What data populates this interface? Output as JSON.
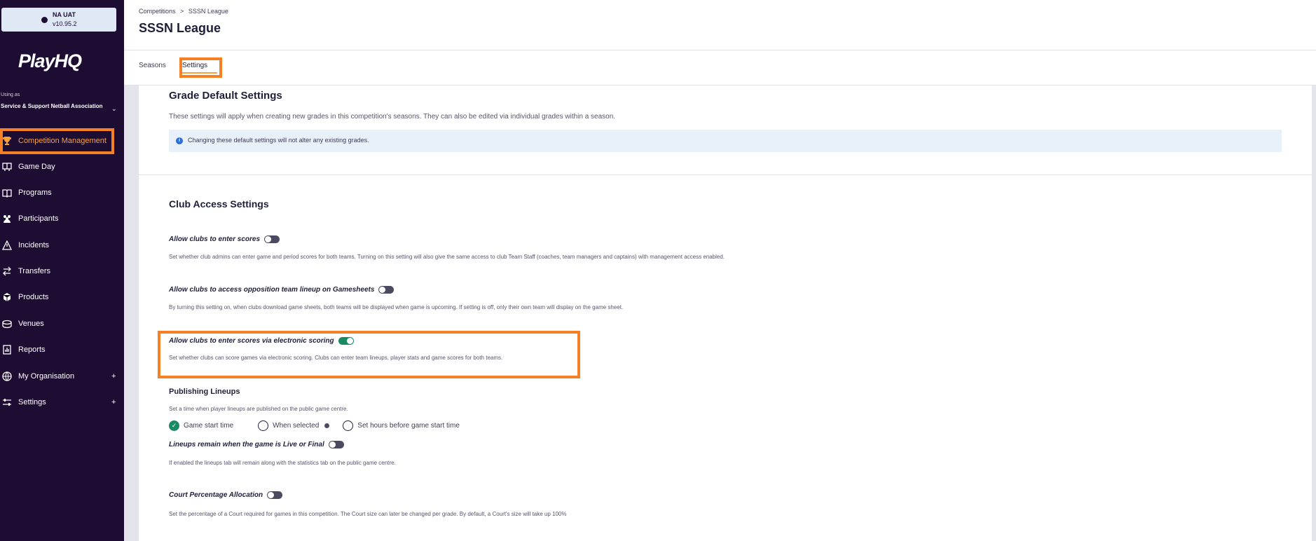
{
  "sidebar": {
    "env": {
      "name": "NA UAT",
      "version": "v10.95.2"
    },
    "logo": "PlayHQ",
    "using_as": "Using as",
    "organisation": "Service & Support Netball Association",
    "items": [
      {
        "label": "Competition Management",
        "icon": "trophy-icon",
        "active": true
      },
      {
        "label": "Game Day",
        "icon": "scoreboard-icon"
      },
      {
        "label": "Programs",
        "icon": "book-icon"
      },
      {
        "label": "Participants",
        "icon": "people-icon"
      },
      {
        "label": "Incidents",
        "icon": "warning-icon"
      },
      {
        "label": "Transfers",
        "icon": "transfer-arrows-icon"
      },
      {
        "label": "Products",
        "icon": "boxes-icon"
      },
      {
        "label": "Venues",
        "icon": "stadium-icon"
      },
      {
        "label": "Reports",
        "icon": "report-icon"
      },
      {
        "label": "My Organisation",
        "icon": "globe-icon",
        "expandable": true
      },
      {
        "label": "Settings",
        "icon": "sliders-icon",
        "expandable": true
      }
    ],
    "expand_symbol": "+"
  },
  "header": {
    "breadcrumb": [
      "Competitions",
      "SSSN League"
    ],
    "breadcrumb_sep": ">",
    "title": "SSSN League"
  },
  "tabs": [
    {
      "label": "Seasons"
    },
    {
      "label": "Settings",
      "active": true
    }
  ],
  "grade_defaults": {
    "title": "Grade Default Settings",
    "description": "These settings will apply when creating new grades in this competition's seasons. They can also be edited via individual grades within a season.",
    "info": "Changing these default settings will not alter any existing grades."
  },
  "club_access": {
    "title": "Club Access Settings",
    "settings": [
      {
        "label": "Allow clubs to enter scores",
        "on": false,
        "description": "Set whether club admins can enter game and period scores for both teams. Turning on this setting will also give the same access to club Team Staff (coaches, team managers and captains) with management access enabled."
      },
      {
        "label": "Allow clubs to access opposition team lineup on Gamesheets",
        "on": false,
        "description": "By turning this setting on, when clubs download game sheets, both teams will be displayed when game is upcoming. If setting is off, only their own team will display on the game sheet."
      },
      {
        "label": "Allow clubs to enter scores via electronic scoring",
        "on": true,
        "description": "Set whether clubs can score games via electronic scoring. Clubs can enter team lineups, player stats and game scores for both teams."
      }
    ]
  },
  "publishing_lineups": {
    "title": "Publishing Lineups",
    "description": "Set a time when player lineups are published on the public game centre.",
    "options": [
      {
        "label": "Game start time",
        "checked": true
      },
      {
        "label": "When selected",
        "checked": false
      },
      {
        "label": "Set hours before game start time",
        "checked": false
      }
    ],
    "remain": {
      "label": "Lineups remain when the game is Live or Final",
      "on": false,
      "description": "If enabled the lineups tab will remain along with the statistics tab on the public game centre."
    }
  },
  "court_percentage": {
    "label": "Court Percentage Allocation",
    "on": false,
    "description": "Set the percentage of a Court required for games in this competition. The Court size can later be changed per grade. By default, a Court's size will take up 100%"
  },
  "colors": {
    "sidebar_bg": "#1e0d33",
    "accent": "#f7a23b",
    "highlight": "#f58025",
    "toggle_on": "#1a8a63",
    "info_bg": "#e8f0f9"
  }
}
